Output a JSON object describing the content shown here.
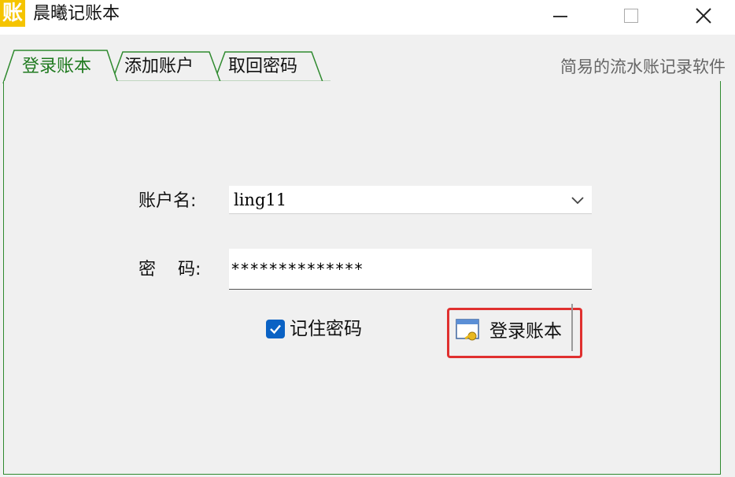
{
  "window": {
    "app_icon_char": "账",
    "title": "晨曦记账本"
  },
  "tabs": [
    {
      "label": "登录账本",
      "active": true
    },
    {
      "label": "添加账户",
      "active": false
    },
    {
      "label": "取回密码",
      "active": false
    }
  ],
  "tagline": "简易的流水账记录软件",
  "form": {
    "account_label": "账户名:",
    "account_value": "ling11",
    "password_label_1": "密",
    "password_label_2": "码:",
    "password_value": "**************",
    "remember_label": "记住密码",
    "remember_checked": true,
    "login_button_label": "登录账本"
  },
  "colors": {
    "tab_accent": "#2f8a2f",
    "checkbox": "#0a62c4",
    "highlight": "#e0302f",
    "app_icon_bg": "#f5c400"
  }
}
